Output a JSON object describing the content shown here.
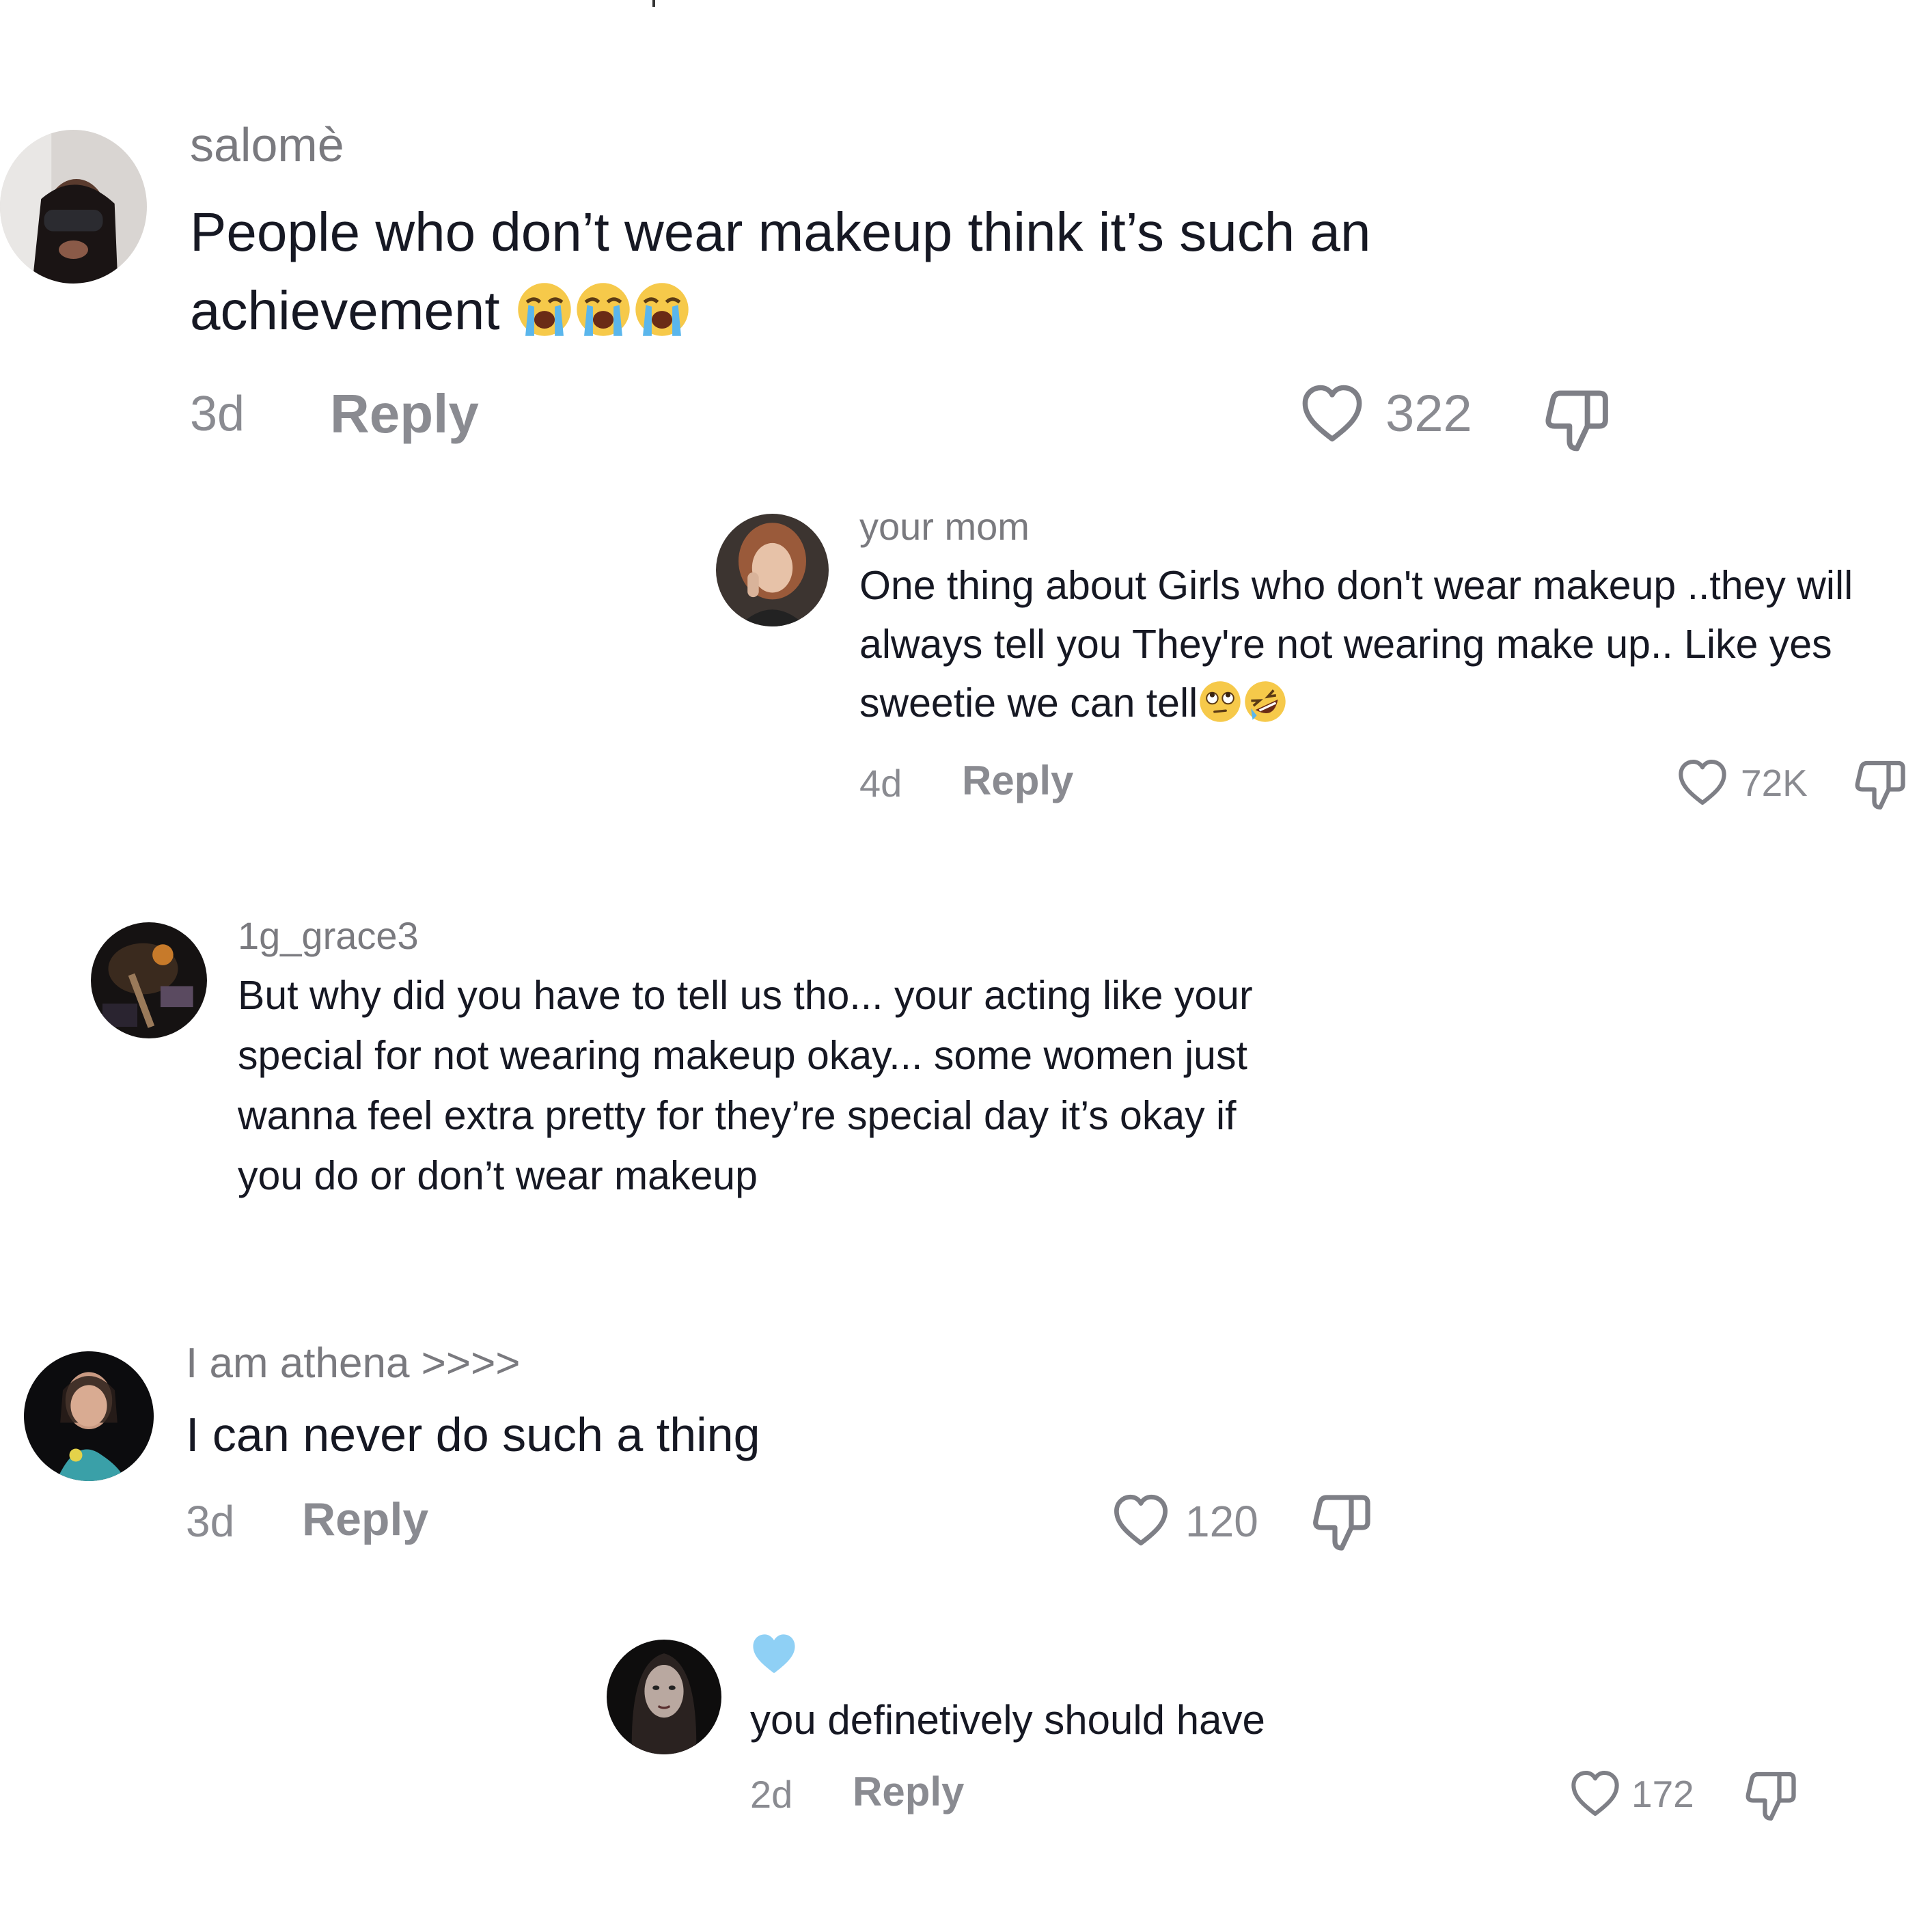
{
  "comments": [
    {
      "username": "salomè",
      "text": "People who don’t wear makeup think it’s such an achievement",
      "emojis": [
        "loudly-crying-face",
        "loudly-crying-face",
        "loudly-crying-face"
      ],
      "age": "3d",
      "reply_label": "Reply",
      "likes": "322"
    },
    {
      "username": "your mom",
      "text": "One thing about Girls who don't wear makeup ..they will always tell you They're not wearing make up.. Like yes sweetie we can tell",
      "emojis": [
        "face-with-rolling-eyes",
        "rolling-on-the-floor-laughing"
      ],
      "age": "4d",
      "reply_label": "Reply",
      "likes": "72K"
    },
    {
      "username": "1g_grace3",
      "text": "But why did you have to tell us tho... your acting like your special for not wearing makeup okay... some women just wanna feel extra pretty for they’re special day it’s okay if you do or don’t wear makeup"
    },
    {
      "username": "I am athena >>>>",
      "text": "I can never do such a thing",
      "age": "3d",
      "reply_label": "Reply",
      "likes": "120"
    },
    {
      "username_icon": "light-blue-heart-icon",
      "text": "you definetively should have",
      "age": "2d",
      "reply_label": "Reply",
      "likes": "172"
    }
  ],
  "colors": {
    "text": "#161823",
    "muted": "#8a8b91",
    "username": "#7a7a7f",
    "background": "#ffffff",
    "heart_accent": "#8fd0f5"
  }
}
